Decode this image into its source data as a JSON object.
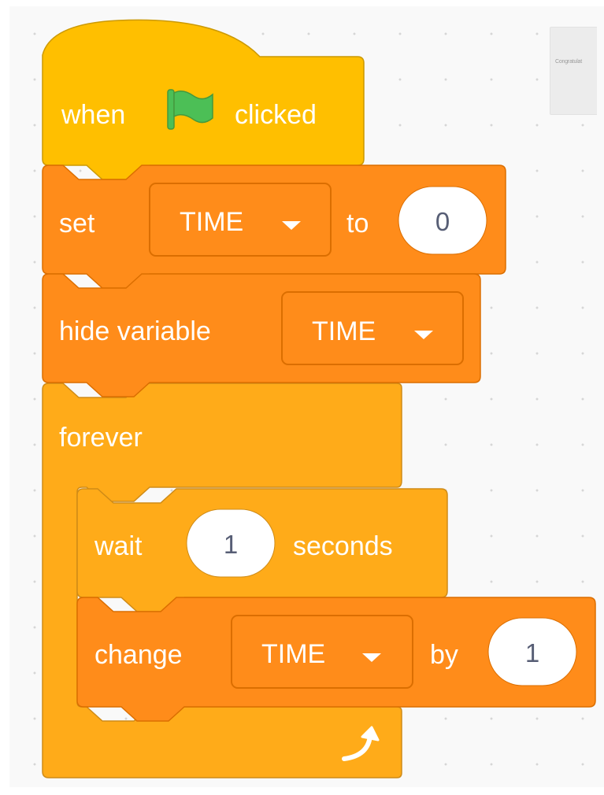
{
  "comment_text": "Congratulat",
  "hat_block": {
    "text_before": "when",
    "icon": "green-flag-icon",
    "text_after": "clicked"
  },
  "set_block": {
    "label": "set",
    "variable": "TIME",
    "mid": "to",
    "value": "0"
  },
  "hide_block": {
    "label": "hide variable",
    "variable": "TIME"
  },
  "forever_block": {
    "label": "forever",
    "loop_icon": "loop-arrow-icon"
  },
  "wait_block": {
    "label": "wait",
    "value": "1",
    "unit": "seconds"
  },
  "change_block": {
    "label": "change",
    "variable": "TIME",
    "mid": "by",
    "value": "1"
  },
  "colors": {
    "events": "#FFBF00",
    "variables": "#FF8C1A",
    "control": "#FFAB19",
    "flag": "#4CBF56",
    "input_text": "#575E75"
  }
}
